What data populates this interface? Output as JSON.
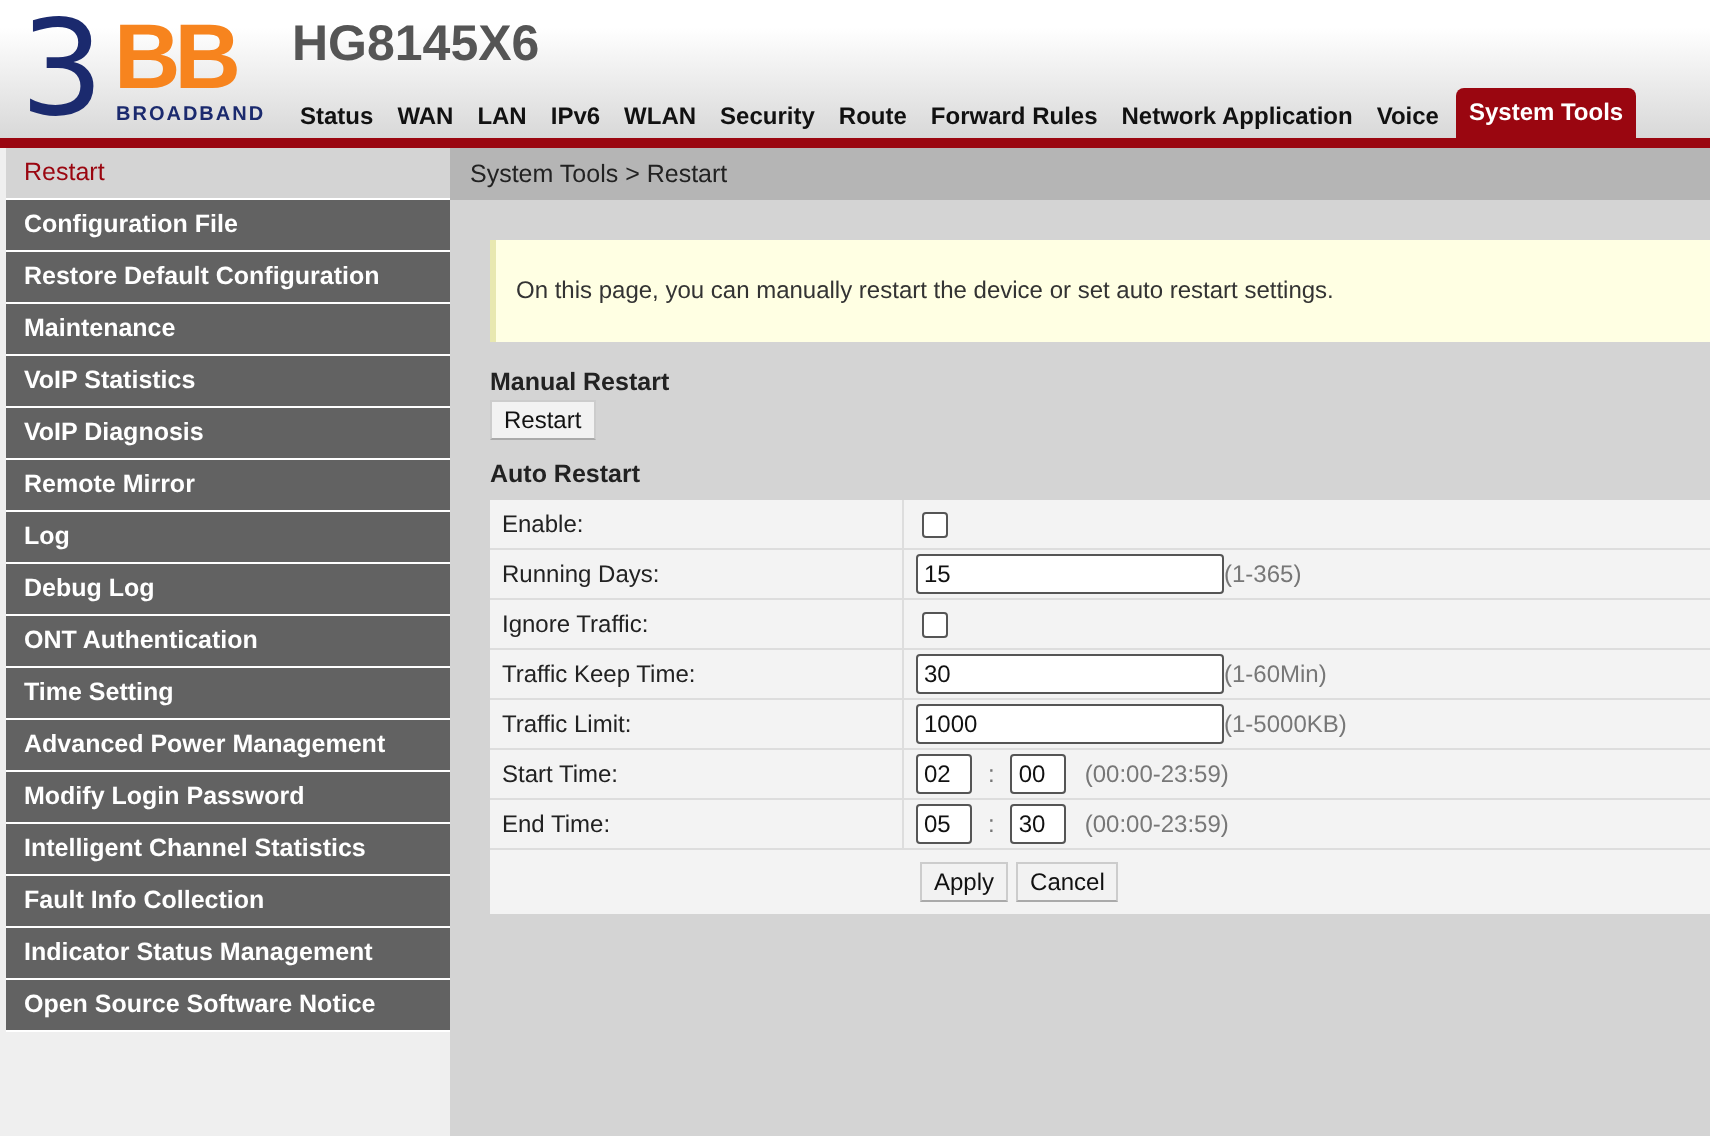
{
  "logo": {
    "digit": "3",
    "letters": "BB",
    "tagline": "BROADBAND"
  },
  "header": {
    "title": "HG8145X6"
  },
  "nav": [
    {
      "label": "Status",
      "selected": false
    },
    {
      "label": "WAN",
      "selected": false
    },
    {
      "label": "LAN",
      "selected": false
    },
    {
      "label": "IPv6",
      "selected": false
    },
    {
      "label": "WLAN",
      "selected": false
    },
    {
      "label": "Security",
      "selected": false
    },
    {
      "label": "Route",
      "selected": false
    },
    {
      "label": "Forward Rules",
      "selected": false
    },
    {
      "label": "Network Application",
      "selected": false
    },
    {
      "label": "Voice",
      "selected": false
    },
    {
      "label": "System Tools",
      "selected": true
    }
  ],
  "sidebar": {
    "items": [
      {
        "label": "Restart",
        "selected": true
      },
      {
        "label": "Configuration File",
        "selected": false
      },
      {
        "label": "Restore Default Configuration",
        "selected": false
      },
      {
        "label": "Maintenance",
        "selected": false
      },
      {
        "label": "VoIP Statistics",
        "selected": false
      },
      {
        "label": "VoIP Diagnosis",
        "selected": false
      },
      {
        "label": "Remote Mirror",
        "selected": false
      },
      {
        "label": "Log",
        "selected": false
      },
      {
        "label": "Debug Log",
        "selected": false
      },
      {
        "label": "ONT Authentication",
        "selected": false
      },
      {
        "label": "Time Setting",
        "selected": false
      },
      {
        "label": "Advanced Power Management",
        "selected": false
      },
      {
        "label": "Modify Login Password",
        "selected": false
      },
      {
        "label": "Intelligent Channel Statistics",
        "selected": false
      },
      {
        "label": "Fault Info Collection",
        "selected": false
      },
      {
        "label": "Indicator Status Management",
        "selected": false
      },
      {
        "label": "Open Source Software Notice",
        "selected": false
      }
    ]
  },
  "breadcrumb": "System Tools > Restart",
  "info": "On this page, you can manually restart the device or set auto restart settings.",
  "manual_restart": {
    "heading": "Manual Restart",
    "button": "Restart"
  },
  "auto_restart": {
    "heading": "Auto Restart",
    "rows": [
      {
        "kind": "checkbox",
        "label": "Enable:",
        "checked": false
      },
      {
        "kind": "text",
        "label": "Running Days:",
        "value": "15",
        "hint": "(1-365)"
      },
      {
        "kind": "checkbox",
        "label": "Ignore Traffic:",
        "checked": false
      },
      {
        "kind": "text",
        "label": "Traffic Keep Time:",
        "value": "30",
        "hint": "(1-60Min)"
      },
      {
        "kind": "text",
        "label": "Traffic Limit:",
        "value": "1000",
        "hint": "(1-5000KB)"
      },
      {
        "kind": "time",
        "label": "Start Time:",
        "hour": "02",
        "separator": ":",
        "minute": "00",
        "hint": "(00:00-23:59)"
      },
      {
        "kind": "time",
        "label": "End Time:",
        "hour": "05",
        "separator": ":",
        "minute": "30",
        "hint": "(00:00-23:59)"
      }
    ],
    "buttons": [
      "Apply",
      "Cancel"
    ]
  }
}
